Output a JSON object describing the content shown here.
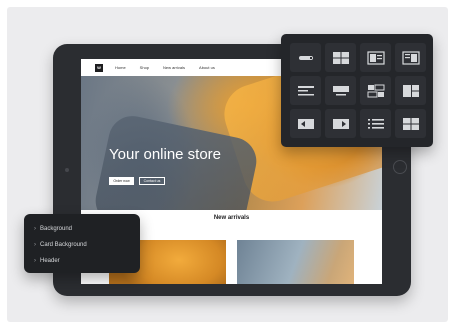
{
  "site": {
    "logo_text": "W",
    "nav": [
      "Home",
      "Shop",
      "New arrivals",
      "About us"
    ],
    "hero": {
      "title": "Your online store",
      "buttons": [
        "Order now",
        "Contact us"
      ]
    },
    "arrivals": {
      "title": "New arrivals"
    }
  },
  "block_icons": [
    "button-block-icon",
    "two-column-grid-icon",
    "image-text-icon",
    "text-image-icon",
    "text-lines-icon",
    "centered-card-icon",
    "mixed-grid-icon",
    "side-grid-icon",
    "image-left-icon",
    "image-right-icon",
    "list-icon",
    "four-grid-icon"
  ],
  "menu": {
    "items": [
      "Background",
      "Card Background",
      "Header"
    ]
  },
  "colors": {
    "panel_bg": "#24262a",
    "tablet_frame": "#2b2d31",
    "accent_orange": "#e8a035"
  }
}
